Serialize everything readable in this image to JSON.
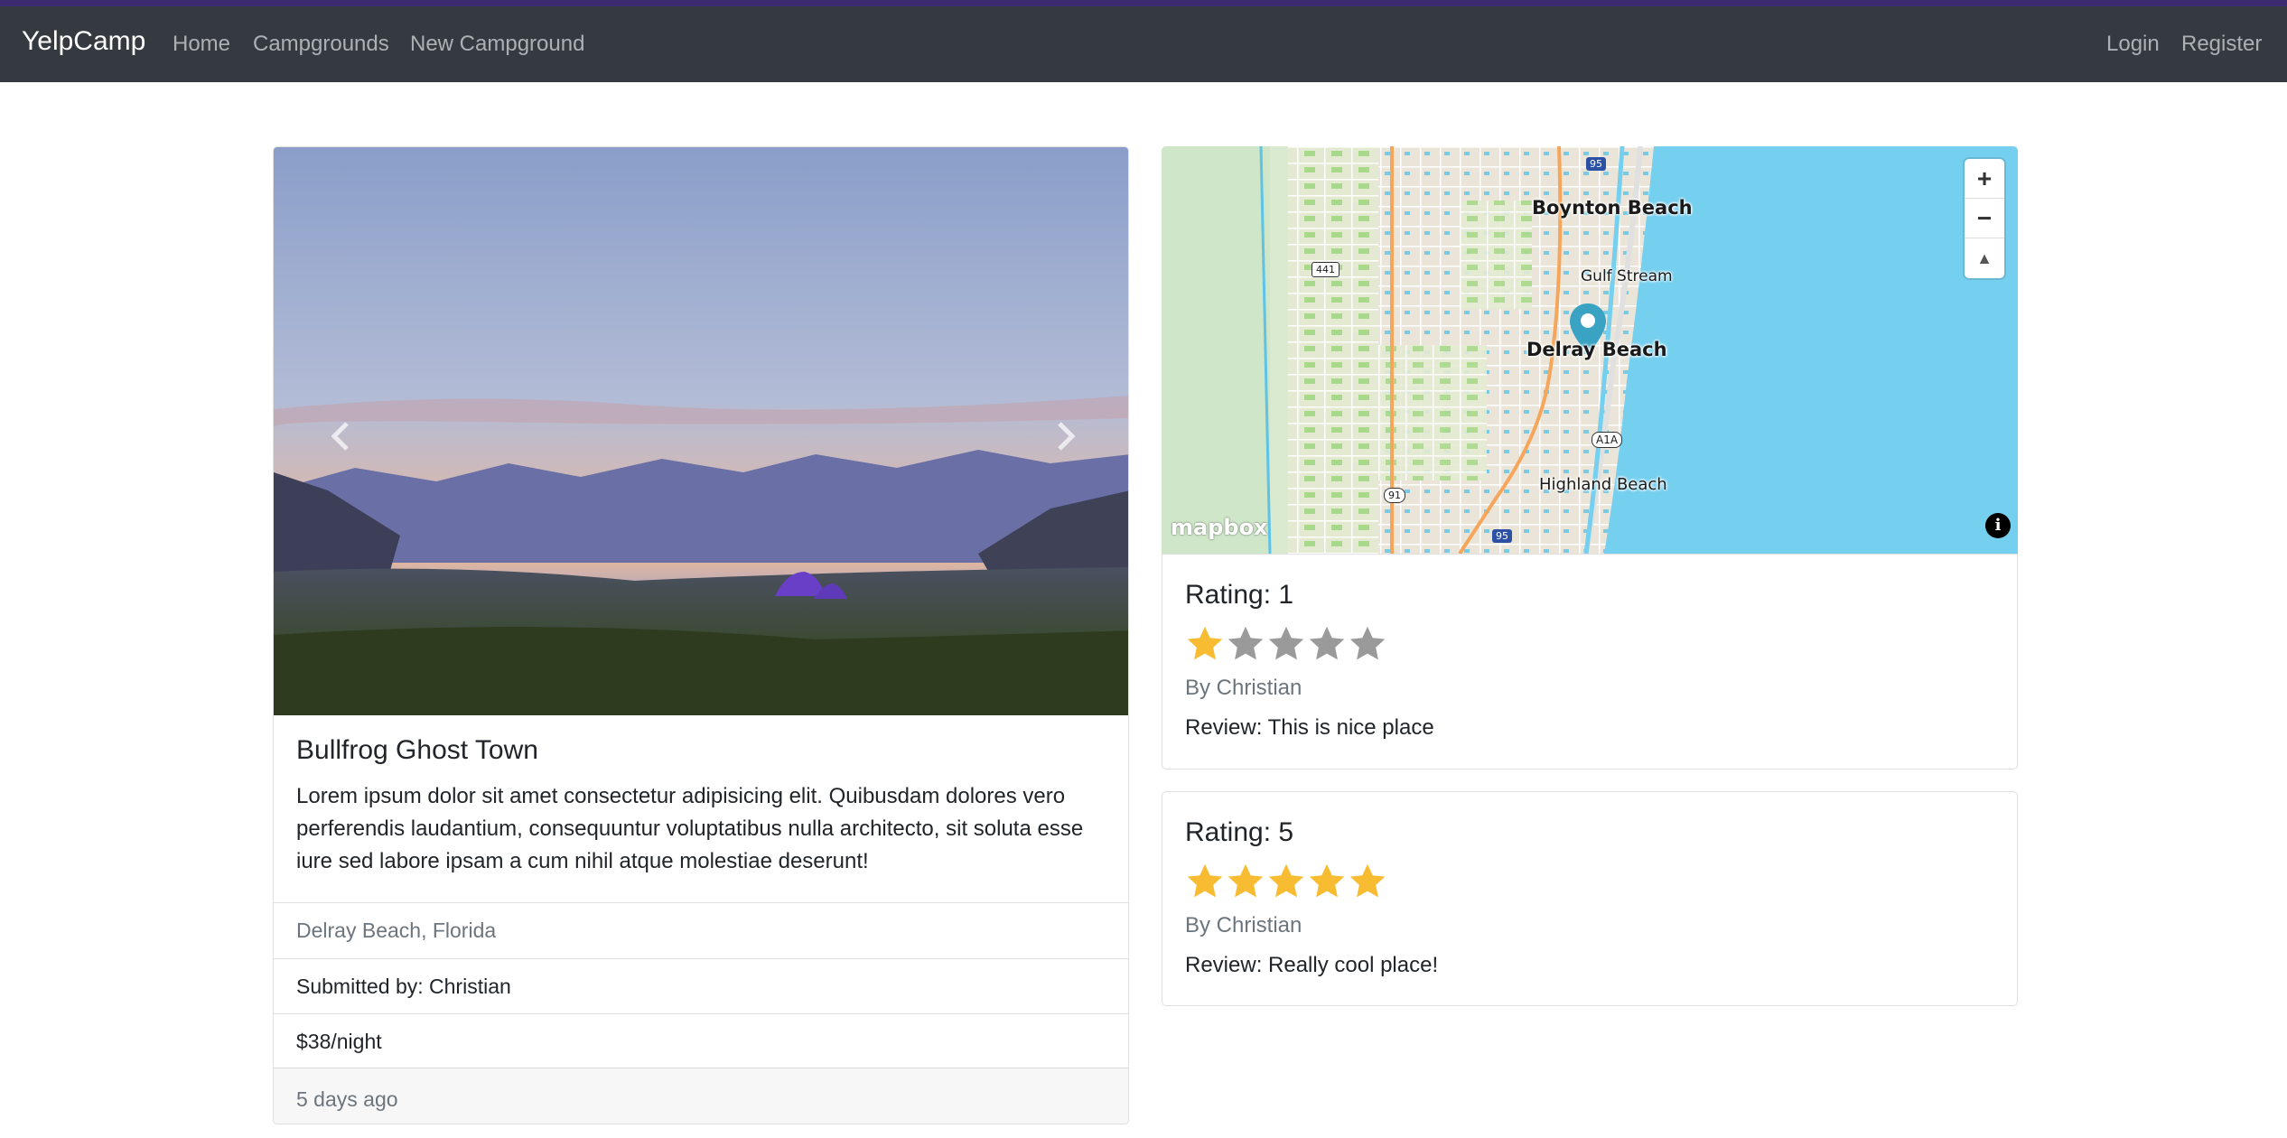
{
  "navbar": {
    "brand": "YelpCamp",
    "links": [
      "Home",
      "Campgrounds",
      "New Campground"
    ],
    "auth": [
      "Login",
      "Register"
    ]
  },
  "campground": {
    "title": "Bullfrog Ghost Town",
    "description": "Lorem ipsum dolor sit amet consectetur adipisicing elit. Quibusdam dolores vero perferendis laudantium, consequuntur voluptatibus nulla architecto, sit soluta esse iure sed labore ipsam a cum nihil atque molestiae deserunt!",
    "location": "Delray Beach, Florida",
    "submitted_by": "Submitted by: Christian",
    "price": "$38/night",
    "posted": "5 days ago"
  },
  "map": {
    "labels": [
      "Boynton Beach",
      "Gulf Stream",
      "Delray Beach",
      "Highland Beach"
    ],
    "shields": [
      "95",
      "441",
      "A1A",
      "91",
      "95"
    ],
    "logo": "mapbox",
    "zoom_in": "+",
    "zoom_out": "−",
    "compass": "▲",
    "info": "i"
  },
  "reviews": [
    {
      "title": "Rating: 1",
      "rating": 1,
      "author": "By Christian",
      "text": "Review: This is nice place"
    },
    {
      "title": "Rating: 5",
      "rating": 5,
      "author": "By Christian",
      "text": "Review: Really cool place!"
    }
  ],
  "colors": {
    "navbar": "#343a40",
    "star_filled": "#f7bc32",
    "star_empty": "#9a9a9a",
    "water": "#75cfef"
  },
  "icons": {
    "carousel_prev": "chevron-left-icon",
    "carousel_next": "chevron-right-icon",
    "map_marker": "map-pin-icon",
    "star": "star-icon"
  }
}
